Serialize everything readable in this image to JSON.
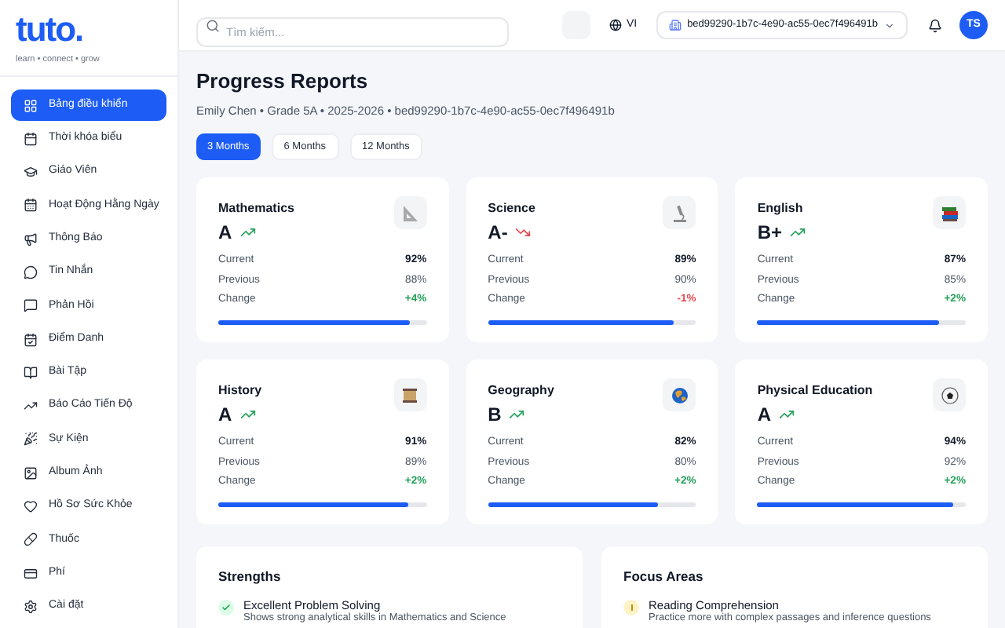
{
  "brand": {
    "logo": "tuto.",
    "tagline": "learn • connect • grow"
  },
  "sidebar": {
    "items": [
      {
        "label": "Bảng điều khiển",
        "selected": true
      },
      {
        "label": "Thời khóa biểu",
        "selected": false
      },
      {
        "label": "Giáo Viên",
        "selected": false
      },
      {
        "label": "Hoạt Động Hằng Ngày",
        "selected": false
      },
      {
        "label": "Thông Báo",
        "selected": false
      },
      {
        "label": "Tin Nhắn",
        "selected": false
      },
      {
        "label": "Phản Hồi",
        "selected": false
      },
      {
        "label": "Điểm Danh",
        "selected": false
      },
      {
        "label": "Bài Tập",
        "selected": false
      },
      {
        "label": "Báo Cáo Tiến Độ",
        "selected": false
      },
      {
        "label": "Sự Kiện",
        "selected": false
      },
      {
        "label": "Album Ảnh",
        "selected": false
      },
      {
        "label": "Hồ Sơ Sức Khỏe",
        "selected": false
      },
      {
        "label": "Thuốc",
        "selected": false
      },
      {
        "label": "Phí",
        "selected": false
      },
      {
        "label": "Cài đặt",
        "selected": false
      }
    ]
  },
  "topbar": {
    "search": {
      "placeholder": "Tìm kiếm..."
    },
    "language": "VI",
    "school_id": "bed99290-1b7c-4e90-ac55-0ec7f496491b",
    "avatar": "TS"
  },
  "page": {
    "title": "Progress Reports",
    "subtitle": "Emily Chen • Grade 5A • 2025-2026 • bed99290-1b7c-4e90-ac55-0ec7f496491b",
    "periods": [
      {
        "label": "3 Months",
        "selected": true
      },
      {
        "label": "6 Months",
        "selected": false
      },
      {
        "label": "12 Months",
        "selected": false
      }
    ]
  },
  "subjects": [
    {
      "name": "Mathematics",
      "grade": "A",
      "kind": "up",
      "current_label": "Current",
      "current": "92%",
      "previous_label": "Previous",
      "previous": "88%",
      "change_label": "Change",
      "change": "+4%",
      "level": 0.92
    },
    {
      "name": "Science",
      "grade": "A-",
      "kind": "down",
      "current_label": "Current",
      "current": "89%",
      "previous_label": "Previous",
      "previous": "90%",
      "change_label": "Change",
      "change": "-1%",
      "level": 0.89
    },
    {
      "name": "English",
      "grade": "B+",
      "kind": "up",
      "current_label": "Current",
      "current": "87%",
      "previous_label": "Previous",
      "previous": "85%",
      "change_label": "Change",
      "change": "+2%",
      "level": 0.87
    },
    {
      "name": "History",
      "grade": "A",
      "kind": "up",
      "current_label": "Current",
      "current": "91%",
      "previous_label": "Previous",
      "previous": "89%",
      "change_label": "Change",
      "change": "+2%",
      "level": 0.91
    },
    {
      "name": "Geography",
      "grade": "B",
      "kind": "up",
      "current_label": "Current",
      "current": "82%",
      "previous_label": "Previous",
      "previous": "80%",
      "change_label": "Change",
      "change": "+2%",
      "level": 0.82
    },
    {
      "name": "Physical Education",
      "grade": "A",
      "kind": "up",
      "current_label": "Current",
      "current": "94%",
      "previous_label": "Previous",
      "previous": "92%",
      "change_label": "Change",
      "change": "+2%",
      "level": 0.94
    }
  ],
  "strengths": {
    "title": "Strengths",
    "items": [
      {
        "title": "Excellent Problem Solving",
        "description": "Shows strong analytical skills in Mathematics and Science"
      }
    ]
  },
  "focus_areas": {
    "title": "Focus Areas",
    "items": [
      {
        "title": "Reading Comprehension",
        "description": "Practice more with complex passages and inference questions"
      }
    ]
  }
}
